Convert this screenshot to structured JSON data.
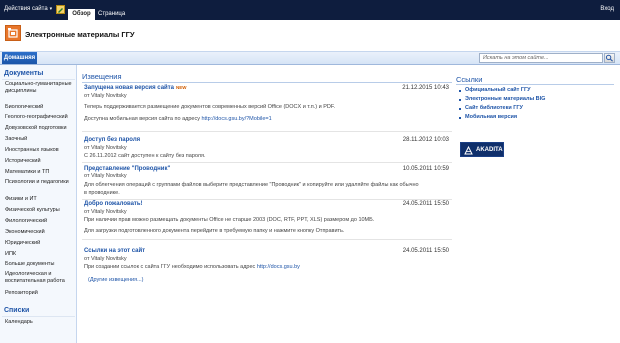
{
  "ribbon": {
    "site_actions": "Действия сайта",
    "tabs": [
      "Обзор",
      "Страница"
    ],
    "signin": "Вход"
  },
  "site": {
    "title": "Электронные материалы ГГУ"
  },
  "nav": {
    "home": "Домашняя"
  },
  "search": {
    "placeholder": "Искать на этом сайте..."
  },
  "quicklaunch": {
    "docs_heading": "Документы",
    "docs": [
      "Социально-гуманитарные дисциплины",
      "Биологический",
      "Геолого-географический",
      "Довузовской подготовки",
      "Заочный",
      "Иностранных языков",
      "Исторический",
      "Математики и ТП",
      "Психологии и педагогики",
      "Физики и ИТ",
      "Физической культуры",
      "Филологический",
      "Экономический",
      "Юридический",
      "ИПК",
      "Больше документы",
      "Идеологическая и воспитательная работа",
      "Репозиторий"
    ],
    "lists_heading": "Списки",
    "lists": [
      "Календарь"
    ]
  },
  "announcements": {
    "heading": "Извещения",
    "items": [
      {
        "title": "Запущена новая версия сайта",
        "date": "21.12.2015 10:43",
        "author": "от Vitaly Novitsky",
        "lines": [
          "Теперь поддерживается размещение документов современных версий Office (DOCX и т.п.) и PDF."
        ],
        "link_prefix": "Доступна мобильная версия сайта по адресу ",
        "link": "http://docs.gsu.by/?Mobile=1"
      },
      {
        "title": "Доступ без пароля",
        "date": "28.11.2012 10:03",
        "author": "от Vitaly Novitsky",
        "lines": [
          "С 26.11.2012 сайт доступен к сайту без пароля."
        ]
      },
      {
        "title": "Представление \"Проводник\"",
        "date": "10.05.2011 10:59",
        "author": "от Vitaly Novitsky",
        "lines": [
          "Для облегчения операций с группами файлов выберите представление \"Проводник\" и копируйте или удаляйте файлы как обычно",
          "в проводнике."
        ]
      },
      {
        "title": "Добро пожаловать!",
        "date": "24.05.2011 15:50",
        "author": "от Vitaly Novitsky",
        "lines": [
          "При наличии прав можно размещать документы Office не старше 2003 (DOC, RTF, PPT, XLS) размером до 10МБ.",
          "Для загрузки подготовленного документа перейдите в требуемую папку и нажмите кнопку Отправить."
        ]
      },
      {
        "title": "Ссылки на этот сайт",
        "date": "24.05.2011 15:50",
        "author": "от Vitaly Novitsky",
        "link_prefix": "При создании ссылок с сайта ГГУ необходимо использовать адрес ",
        "link": "http://docs.gsu.by"
      }
    ],
    "more": "(Другие извещения...)",
    "new_badge": "NEW"
  },
  "links": {
    "heading": "Ссылки",
    "items": [
      "Официальный сайт ГГУ",
      "Электронные материалы BIG",
      "Сайт библиотеки ГГУ",
      "Мобильная версия"
    ],
    "banner": "AKADITA"
  }
}
